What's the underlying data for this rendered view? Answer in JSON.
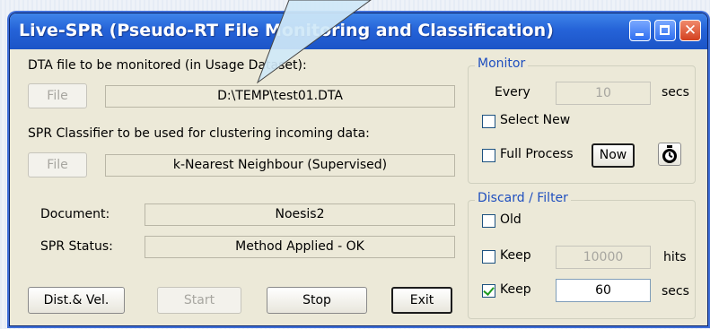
{
  "window": {
    "title": "Live-SPR (Pseudo-RT File Monitoring and Classification)"
  },
  "dta": {
    "label": "DTA file to be monitored (in Usage Dataset):",
    "file_button": "File",
    "path": "D:\\TEMP\\test01.DTA"
  },
  "classifier": {
    "label": "SPR Classifier to be used for clustering incoming data:",
    "file_button": "File",
    "name": "k-Nearest Neighbour (Supervised)"
  },
  "document": {
    "label": "Document:",
    "value": "Noesis2"
  },
  "status": {
    "label": "SPR Status:",
    "value": "Method Applied - OK"
  },
  "monitor": {
    "title": "Monitor",
    "every_label": "Every",
    "every_value": "10",
    "every_unit": "secs",
    "select_new_label": "Select New",
    "full_process_label": "Full Process",
    "now_button": "Now"
  },
  "filter": {
    "title": "Discard / Filter",
    "old_label": "Old",
    "keep_hits_label": "Keep",
    "keep_hits_value": "10000",
    "keep_hits_unit": "hits",
    "keep_secs_label": "Keep",
    "keep_secs_value": "60",
    "keep_secs_unit": "secs"
  },
  "buttons": {
    "dist_vel": "Dist.& Vel.",
    "start": "Start",
    "stop": "Stop",
    "exit": "Exit"
  },
  "colors": {
    "titlebar": "#2563d8",
    "group_title": "#1f4fbf",
    "window_bg": "#ece9d8"
  }
}
